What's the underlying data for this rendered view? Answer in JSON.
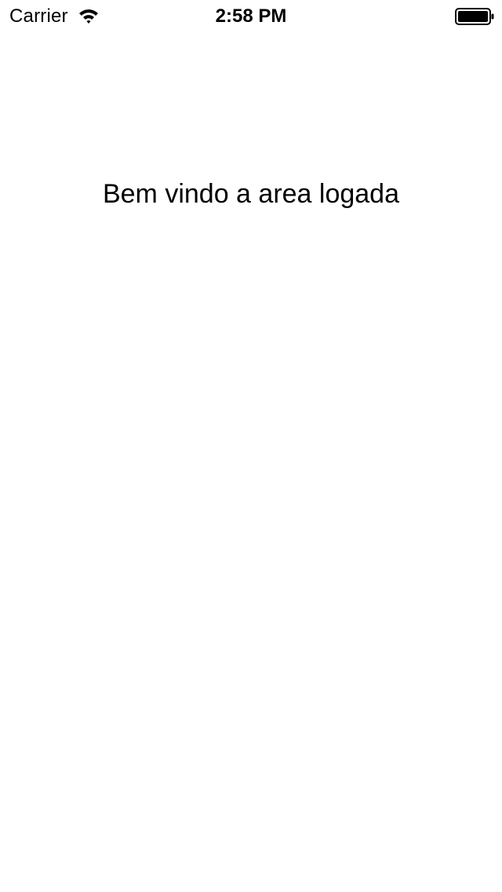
{
  "status_bar": {
    "carrier": "Carrier",
    "time": "2:58 PM",
    "wifi_icon": "wifi-icon",
    "battery_icon": "battery-full-icon"
  },
  "main": {
    "welcome_text": "Bem vindo a area logada"
  },
  "colors": {
    "background": "#ffffff",
    "text": "#000000"
  }
}
